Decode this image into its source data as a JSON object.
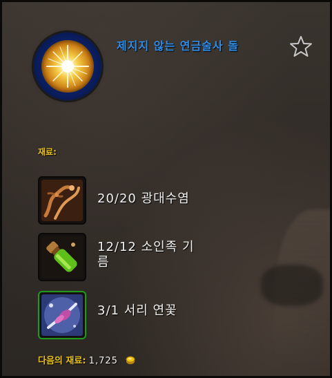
{
  "recipe": {
    "title": "제지지 않는 연금술사 돌",
    "favorite_state": "not-favorited",
    "icon": "radiant-orb-icon"
  },
  "reagents_section": {
    "label": "재료:",
    "items": [
      {
        "count": "20/20",
        "name": "광대수염",
        "icon": "twisted-root-icon",
        "border": "default"
      },
      {
        "count": "12/12",
        "name": "소인족 기\n름",
        "icon": "oil-vial-icon",
        "border": "default"
      },
      {
        "count": "3/1",
        "name": "서리 연꽃",
        "icon": "frost-lotus-icon",
        "border": "green"
      }
    ]
  },
  "cost": {
    "label": "다음의 재료:",
    "value": "1,725",
    "currency_icon": "coin-icon"
  },
  "colors": {
    "title": "#2f8ee8",
    "label_gold": "#e7c21a",
    "text": "#f2f2f2",
    "background": "#322c28",
    "uncommon_border": "#1f9a1f"
  }
}
